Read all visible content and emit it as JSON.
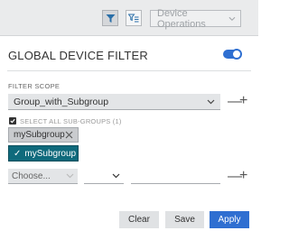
{
  "toolbar": {
    "device_operations_label": "Device Operations"
  },
  "panel": {
    "title": "GLOBAL DEVICE FILTER",
    "toggle_on": true
  },
  "scope": {
    "label": "FILTER SCOPE",
    "selected": "Group_with_Subgroup",
    "remove_symbol": "—",
    "add_symbol": "+"
  },
  "subgroups": {
    "select_all_label": "SELECT ALL SUB-GROUPS (1)",
    "select_all_checked": true,
    "chip_label": "mySubgroup",
    "option_label": "mySubgroup",
    "option_check": "✓"
  },
  "condition": {
    "field_placeholder": "Choose...",
    "remove_symbol": "—",
    "add_symbol": "+"
  },
  "actions": {
    "clear": "Clear",
    "save": "Save",
    "apply": "Apply"
  },
  "colors": {
    "accent": "#2f6fd1",
    "selected_option": "#0f6a7c"
  },
  "icons": {
    "filter": "filter-icon",
    "filter_list": "filter-list-icon",
    "chevron": "chevron-down-icon",
    "close": "close-icon"
  }
}
